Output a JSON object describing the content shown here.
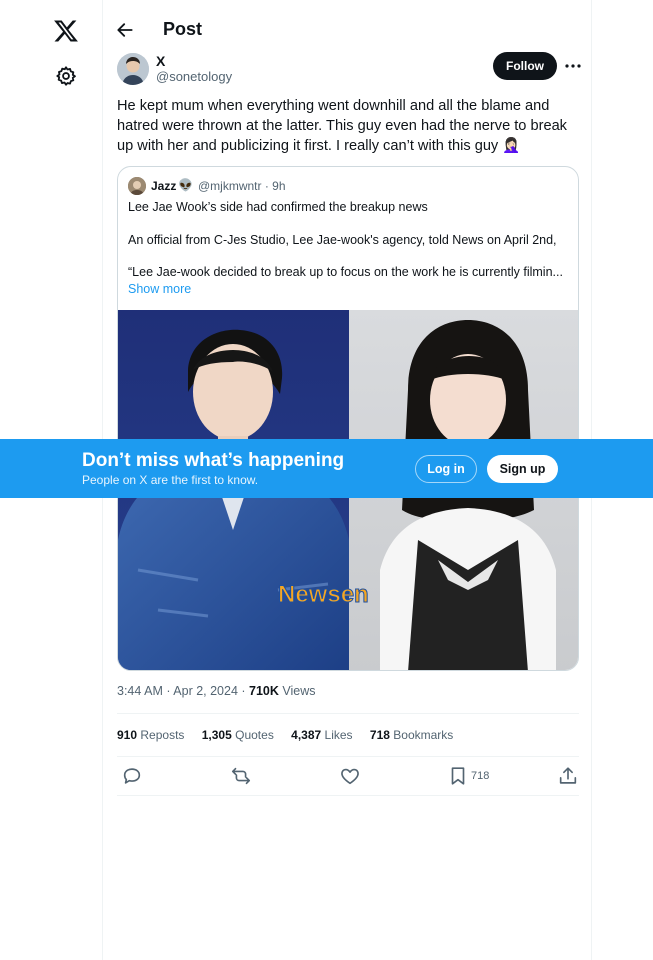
{
  "nav": {
    "logo_icon": "x-logo-icon",
    "settings_icon": "gear-icon"
  },
  "header": {
    "back_icon": "arrow-left-icon",
    "title": "Post"
  },
  "post": {
    "author": {
      "name": "X",
      "handle": "@sonetology"
    },
    "follow_label": "Follow",
    "more_icon": "ellipsis-icon",
    "text": "He kept mum when everything went downhill and all the blame and hatred were thrown at the latter. This guy even had the nerve to break up with her and publicizing it first. I really can’t with this guy 🤦🏻‍♀️",
    "quote": {
      "name": "Jazz",
      "emoji": "👽",
      "meta": "@mjkmwntr · 9h",
      "lines": [
        "Lee Jae Wook’s side had confirmed the breakup news",
        "An official from C-Jes Studio, Lee Jae-wook's agency, told News on April 2nd,",
        "“Lee Jae-wook decided to break up to focus on the work he is currently filmin..."
      ],
      "show_more": "Show more",
      "image_watermark": "Newsen"
    },
    "time": "3:44 AM · Apr 2, 2024 · ",
    "views_count": "710K",
    "views_label": " Views",
    "stats": [
      {
        "count": "910",
        "label": "Reposts"
      },
      {
        "count": "1,305",
        "label": "Quotes"
      },
      {
        "count": "4,387",
        "label": "Likes"
      },
      {
        "count": "718",
        "label": "Bookmarks"
      }
    ],
    "actions": {
      "reply_icon": "reply-icon",
      "repost_icon": "repost-icon",
      "like_icon": "heart-icon",
      "bookmark_icon": "bookmark-icon",
      "bookmark_count": "718",
      "share_icon": "share-icon"
    }
  },
  "banner": {
    "title": "Don’t miss what’s happening",
    "subtitle": "People on X are the first to know.",
    "login_label": "Log in",
    "signup_label": "Sign up"
  }
}
